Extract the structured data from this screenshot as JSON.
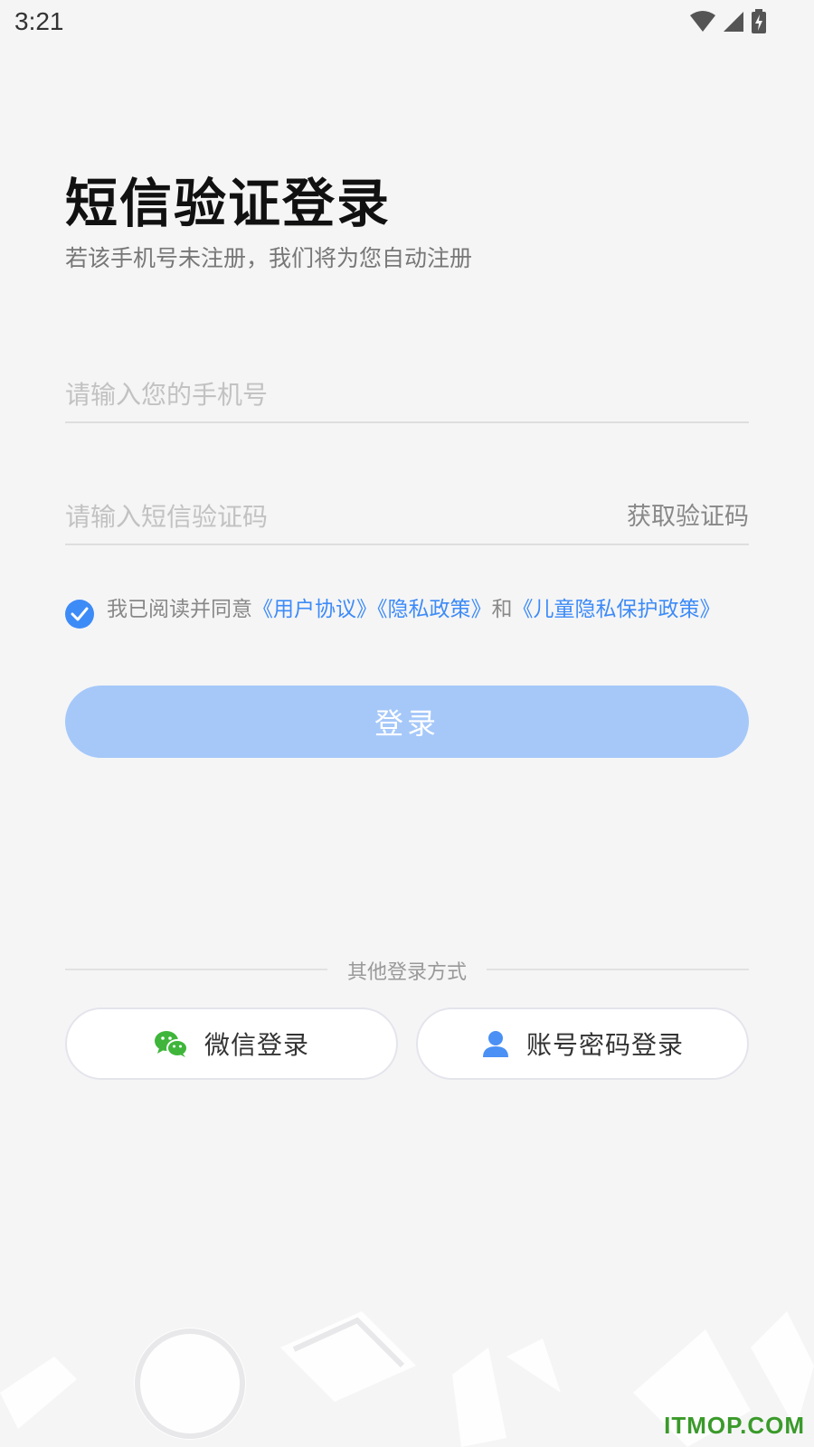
{
  "status_bar": {
    "time": "3:21",
    "icons": [
      "wifi-icon",
      "signal-icon",
      "battery-charging-icon"
    ]
  },
  "header": {
    "title": "短信验证登录",
    "subtitle": "若该手机号未注册，我们将为您自动注册"
  },
  "form": {
    "phone_placeholder": "请输入您的手机号",
    "phone_value": "",
    "code_placeholder": "请输入短信验证码",
    "code_value": "",
    "get_code_label": "获取验证码"
  },
  "agreement": {
    "checked": true,
    "prefix": "我已阅读并同意",
    "user_agreement": "《用户协议》",
    "privacy_policy": "《隐私政策》",
    "and": "和",
    "child_privacy": "《儿童隐私保护政策》"
  },
  "login_button": {
    "label": "登录"
  },
  "other_login": {
    "divider_label": "其他登录方式",
    "wechat_label": "微信登录",
    "account_label": "账号密码登录"
  },
  "watermark": "ITMOP.COM",
  "colors": {
    "accent": "#3d8bf7",
    "login_button_disabled": "#a5c8f9",
    "background": "#f5f5f6",
    "wechat_green": "#3fb63b"
  }
}
